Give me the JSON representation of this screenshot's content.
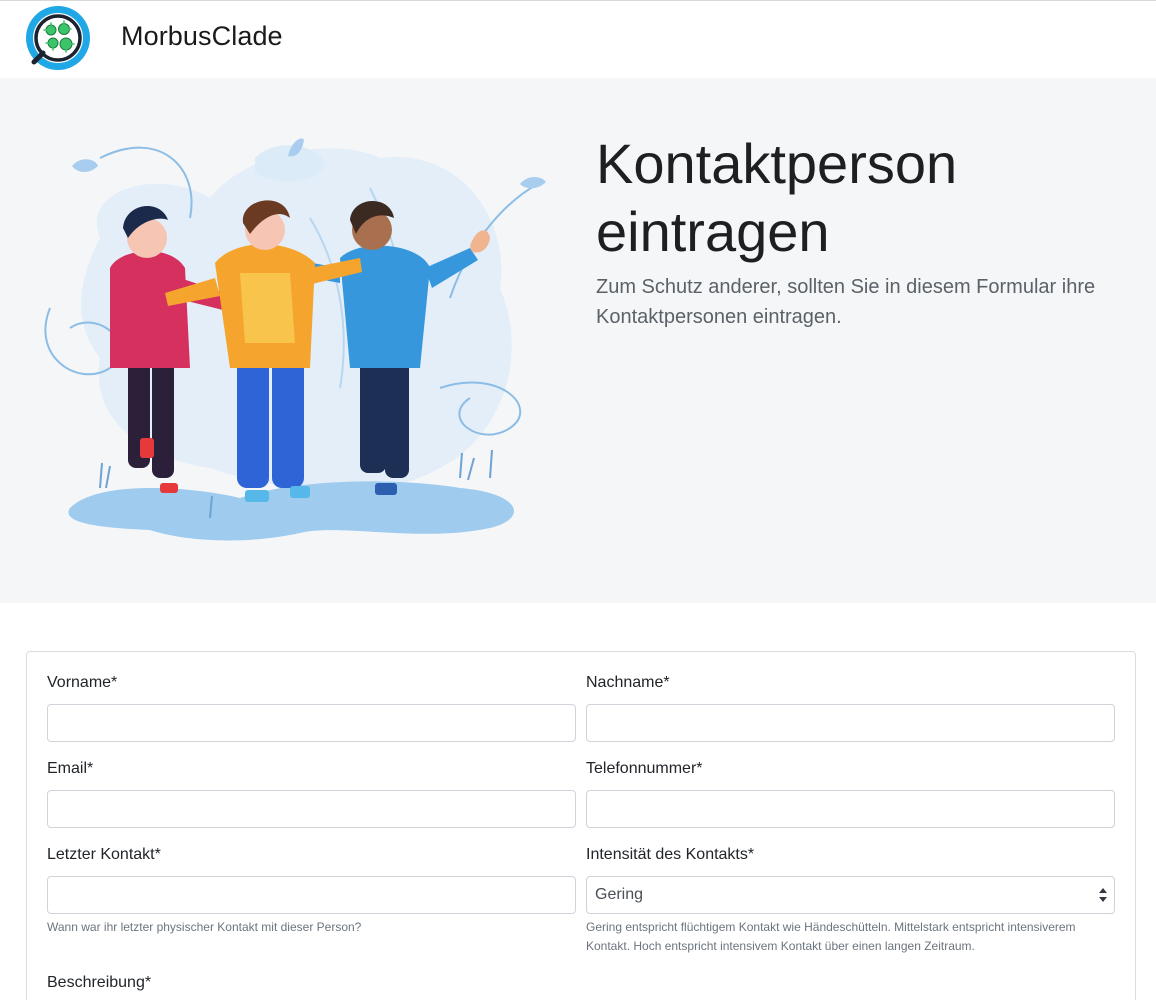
{
  "app": {
    "brand": "MorbusClade"
  },
  "hero": {
    "title_line1": "Kontaktperson",
    "title_line2": "eintragen",
    "lead": "Zum Schutz anderer, sollten Sie in diesem Formular ihre Kontaktpersonen eintragen."
  },
  "form": {
    "vorname": {
      "label": "Vorname*",
      "value": ""
    },
    "nachname": {
      "label": "Nachname*",
      "value": ""
    },
    "email": {
      "label": "Email*",
      "value": ""
    },
    "telefon": {
      "label": "Telefonnummer*",
      "value": ""
    },
    "letzter_kontakt": {
      "label": "Letzter Kontakt*",
      "value": "",
      "help": "Wann war ihr letzter physischer Kontakt mit dieser Person?"
    },
    "intensitaet": {
      "label": "Intensität des Kontakts*",
      "selected": "Gering",
      "help": "Gering entspricht flüchtigem Kontakt wie Händeschütteln. Mittelstark entspricht intensiverem Kontakt. Hoch entspricht intensivem Kontakt über einen langen Zeitraum."
    },
    "beschreibung": {
      "label": "Beschreibung*"
    }
  },
  "colors": {
    "hero_bg": "#f5f6f8",
    "logo_ring": "#1fa7e6",
    "virus_green": "#3cc46a"
  }
}
